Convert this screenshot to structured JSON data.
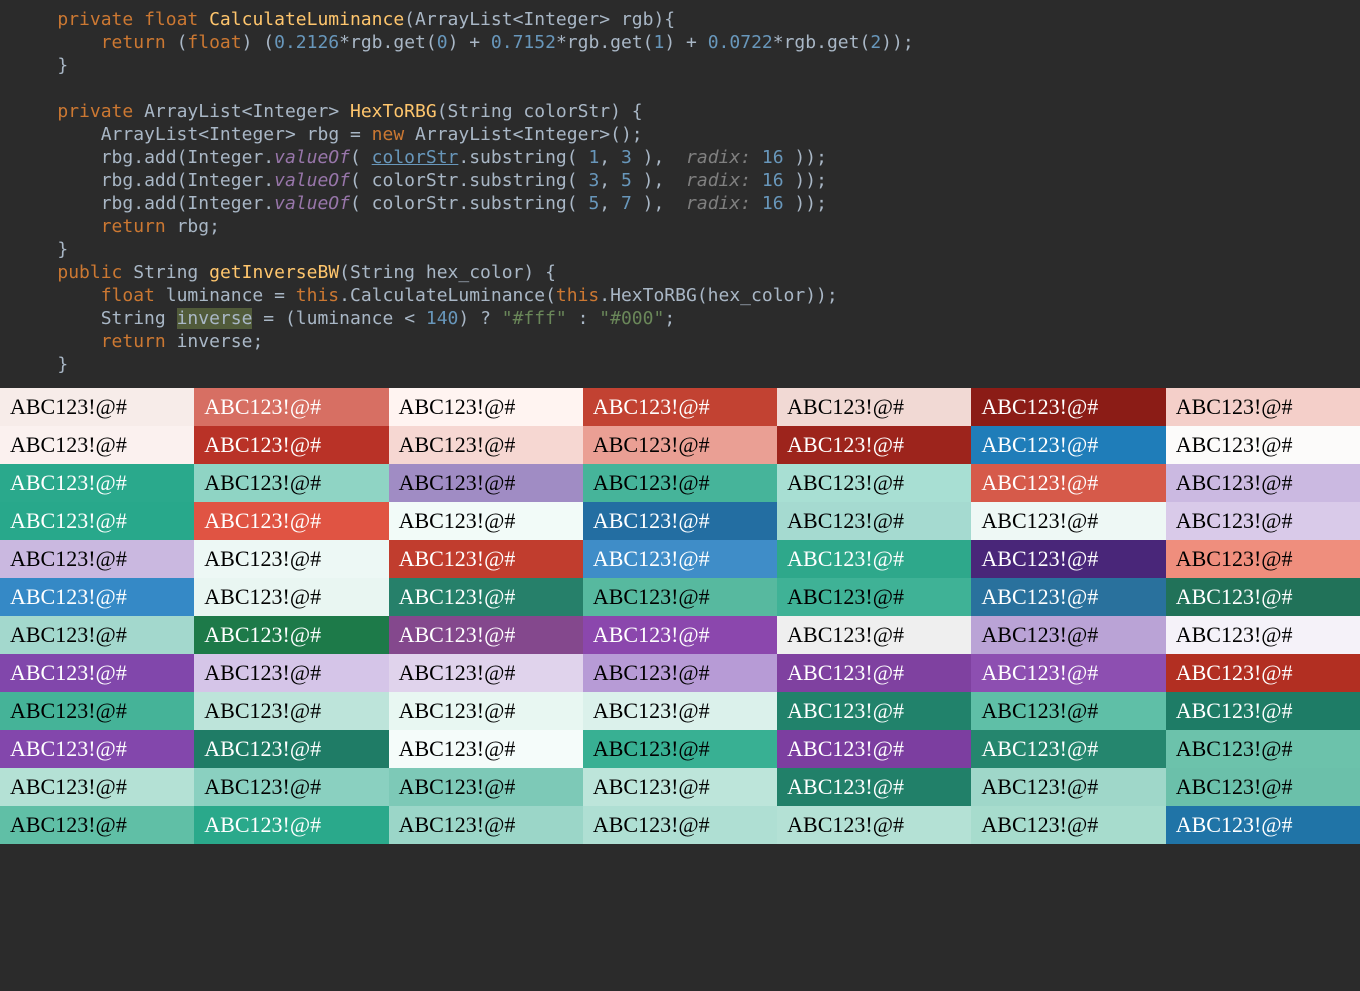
{
  "code": {
    "t": {
      "private": "private",
      "float": "float",
      "return": "return",
      "kw_this": "this",
      "ArrayList": "ArrayList",
      "Integer": "Integer",
      "String": "String",
      "public": "public",
      "new": "new",
      "CalculateLuminance": "CalculateLuminance",
      "HexToRBG": "HexToRBG",
      "getInverseBW": "getInverseBW",
      "rgb": "rgb",
      "rbg": "rbg",
      "colorStr": "colorStr",
      "hex_color": "hex_color",
      "luminance": "luminance",
      "inverse": "inverse",
      "get": "get",
      "add": "add",
      "valueOf": "valueOf",
      "substring": "substring",
      "n0": "0",
      "n1": "1",
      "n2": "2",
      "n3": "3",
      "n5": "5",
      "n7": "7",
      "n16": "16",
      "n140": "140",
      "c02126": "0.2126",
      "c07152": "0.7152",
      "c00722": "0.0722",
      "radix": "radix:",
      "fff": "\"#fff\"",
      "zzz": "\"#000\"",
      "lt": "<",
      "gt": ">"
    }
  },
  "sample_text": "ABC123!@#",
  "swatches": [
    [
      "#f7ece9",
      "#d76f63",
      "#fff4f1",
      "#c24232",
      "#f1d9d4",
      "#8b1c16",
      "#f4cfc9"
    ],
    [
      "#fbf1ef",
      "#b93227",
      "#f6d7d2",
      "#ea9f94",
      "#9d241c",
      "#1f7db9",
      "#fcfbfa"
    ],
    [
      "#2aa98c",
      "#8fd4c4",
      "#a08cc4",
      "#46b49a",
      "#a8dfd3",
      "#d65a4a",
      "#cbb9e1"
    ],
    [
      "#28a88b",
      "#e05443",
      "#f2fbf8",
      "#236ea2",
      "#a5dad0",
      "#eef8f5",
      "#d9cae9"
    ],
    [
      "#cab8e0",
      "#edf8f5",
      "#c13d2e",
      "#3f8dc8",
      "#2ea88b",
      "#492679",
      "#ef8e7d"
    ],
    [
      "#3589c6",
      "#e9f6f2",
      "#26806a",
      "#57b99f",
      "#3fb296",
      "#29719d",
      "#217259"
    ],
    [
      "#a3d8cd",
      "#1d7a49",
      "#84488d",
      "#8b47ad",
      "#efefef",
      "#baa3d6",
      "#f5f2f9"
    ],
    [
      "#8147ab",
      "#d5c5e8",
      "#e0d3ec",
      "#b79bd6",
      "#7f41a0",
      "#8d4fb1",
      "#b22f22"
    ],
    [
      "#45b398",
      "#bde4da",
      "#e8f7f2",
      "#dbf1eb",
      "#21826b",
      "#5fbfa7",
      "#1e7c66"
    ],
    [
      "#8347ac",
      "#1f7c66",
      "#f5fcfa",
      "#38b093",
      "#7c3ea0",
      "#25866e",
      "#6cc2ab"
    ],
    [
      "#b4e1d5",
      "#8ad0c0",
      "#7dc9b7",
      "#bde5da",
      "#218069",
      "#9fd7c9",
      "#6bc0aa"
    ],
    [
      "#60bfa6",
      "#2aa98b",
      "#9bd6c8",
      "#afdfd3",
      "#b4e1d5",
      "#a7dccd",
      "#2074a7"
    ]
  ]
}
